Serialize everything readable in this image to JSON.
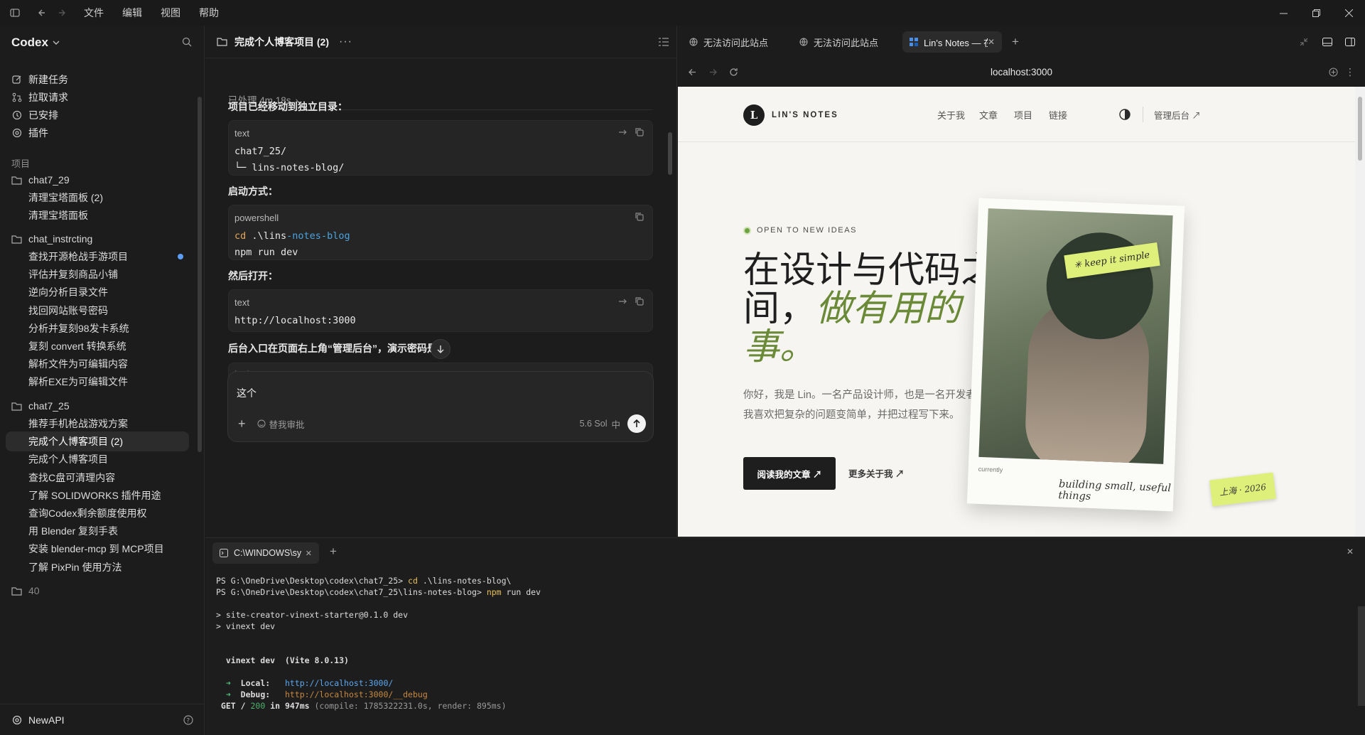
{
  "menu": {
    "file": "文件",
    "edit": "编辑",
    "view": "视图",
    "help": "帮助"
  },
  "sidebar": {
    "brand": "Codex",
    "actions": [
      {
        "label": "新建任务",
        "icon": "edit-icon"
      },
      {
        "label": "拉取请求",
        "icon": "pull-request-icon"
      },
      {
        "label": "已安排",
        "icon": "clock-icon"
      },
      {
        "label": "插件",
        "icon": "plugin-icon"
      }
    ],
    "projects_heading": "项目",
    "groups": [
      {
        "name": "chat7_29",
        "tasks": [
          "清理宝塔面板 (2)",
          "清理宝塔面板"
        ]
      },
      {
        "name": "chat_instrcting",
        "tasks": [
          "查找开源枪战手游项目",
          "评估并复刻商品小铺",
          "逆向分析目录文件",
          "找回网站账号密码",
          "分析并复刻98发卡系统",
          "复刻 convert 转换系统",
          "解析文件为可编辑内容",
          "解析EXE为可编辑文件"
        ]
      },
      {
        "name": "chat7_25",
        "tasks": [
          "推荐手机枪战游戏方案",
          "完成个人博客项目 (2)",
          "完成个人博客项目",
          "查找C盘可清理内容",
          "了解 SOLIDWORKS 插件用途",
          "查询Codex剩余额度使用权",
          "用 Blender 复刻手表",
          "安装 blender-mcp 到 MCP项目",
          "了解 PixPin 使用方法"
        ]
      },
      {
        "name": "40",
        "tasks": []
      }
    ],
    "footer": "NewAPI"
  },
  "chat": {
    "title": "完成个人博客项目 (2)",
    "processed": "已处理 4m 18s",
    "p1": "项目已经移动到独立目录：",
    "code1": {
      "lang": "text",
      "line1": "chat7_25/",
      "line2": "└─ lins-notes-blog/"
    },
    "p2": "启动方式：",
    "code2": {
      "lang": "powershell",
      "cmd": "cd",
      "arg_a": " .\\lins",
      "arg_b": "-notes-blog",
      "line2": "npm run dev"
    },
    "p3": "然后打开：",
    "code3": {
      "lang": "text",
      "line1": "http://localhost:3000"
    },
    "p4": "后台入口在页面右上角“管理后台”，演示密码是",
    "code4_lang": "text",
    "composer": {
      "text": "这个",
      "approval": "替我审批",
      "model": "5.6 Sol",
      "mode": "中"
    }
  },
  "browser": {
    "tabs": [
      "无法访问此站点",
      "无法访问此站点",
      "Lin's Notes — 在"
    ],
    "url": "localhost:3000",
    "site": {
      "logo_letter": "L",
      "name": "LIN'S NOTES",
      "nav": [
        "关于我",
        "文章",
        "项目",
        "链接"
      ],
      "admin": "管理后台 ↗",
      "tag": "OPEN TO NEW IDEAS",
      "h1_a": "在设计与代码之间，",
      "h1_b": "做有用的事。",
      "intro1": "你好，我是 Lin。一名产品设计师，也是一名开发者。",
      "intro2": "我喜欢把复杂的问题变简单，并把过程写下来。",
      "btn_primary": "阅读我的文章  ↗",
      "btn_secondary": "更多关于我  ↗",
      "sticker_a": "✳ keep it simple",
      "sticker_b": "上海 · 2026",
      "caption_small": "currently",
      "caption": "building small, useful things"
    }
  },
  "terminal": {
    "tab": "C:\\WINDOWS\\sy",
    "l1_prompt": "PS G:\\OneDrive\\Desktop\\codex\\chat7_25> ",
    "l1_cmd": "cd",
    "l1_rest": " .\\lins-notes-blog\\",
    "l2_prompt": "PS G:\\OneDrive\\Desktop\\codex\\chat7_25\\lins-notes-blog> ",
    "l2_cmd": "npm",
    "l2_rest": " run dev",
    "l3": "> site-creator-vinext-starter@0.1.0 dev",
    "l4": "> vinext dev",
    "l5": "  vinext dev  (Vite 8.0.13)",
    "local_label": "Local:   ",
    "local_url": "http://localhost:3000/",
    "debug_label": "Debug:   ",
    "debug_url": "http://localhost:3000/__debug",
    "get_a": " GET / ",
    "get_code": "200",
    "get_b": " in 947ms ",
    "get_dim": "(compile: 1785322231.0s, render: 895ms)"
  },
  "colors": {
    "accent_green": "#6a8a37",
    "sticker": "#dff07a",
    "unread_dot": "#5b9df7"
  }
}
